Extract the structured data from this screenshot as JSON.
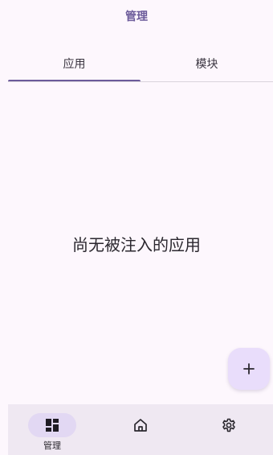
{
  "header": {
    "title": "管理"
  },
  "tabs": [
    {
      "label": "应用",
      "active": true
    },
    {
      "label": "模块",
      "active": false
    }
  ],
  "main": {
    "empty_message": "尚无被注入的应用"
  },
  "fab": {
    "icon": "plus-icon"
  },
  "bottom_nav": {
    "items": [
      {
        "label": "管理",
        "icon": "dashboard-icon",
        "active": true
      },
      {
        "label": "",
        "icon": "home-icon",
        "active": false
      },
      {
        "label": "",
        "icon": "settings-gear-icon",
        "active": false
      }
    ]
  },
  "colors": {
    "background": "#fdf7fd",
    "accent": "#6b5a9a",
    "fab_background": "#e9ddfb",
    "nav_background": "#efe8f2"
  }
}
